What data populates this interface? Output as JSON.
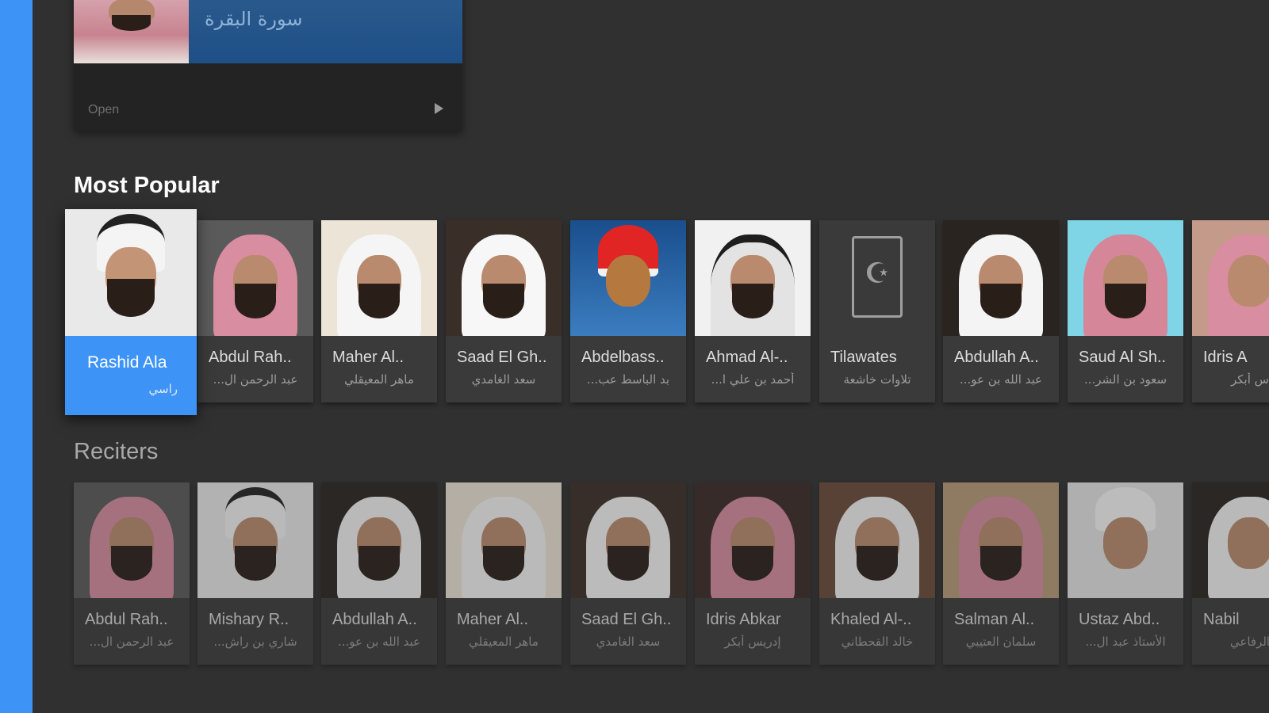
{
  "top_card": {
    "banner_text": "سورة البقرة",
    "open_label": "Open",
    "play_icon": "play-icon"
  },
  "sections": {
    "most_popular": "Most Popular",
    "reciters": "Reciters"
  },
  "most_popular": [
    {
      "name": "Rashid Ala",
      "subname": "راسي",
      "focused": true
    },
    {
      "name": "Abdul Rah..",
      "subname": "عبد الرحمن ال..."
    },
    {
      "name": "Maher Al..",
      "subname": "ماهر المعيقلي"
    },
    {
      "name": "Saad El Gh..",
      "subname": "سعد الغامدي"
    },
    {
      "name": "Abdelbass..",
      "subname": "بد الباسط عب..."
    },
    {
      "name": "Ahmad Al-..",
      "subname": "أحمد بن علي ا..."
    },
    {
      "name": "Tilawates",
      "subname": "تلاوات خاشعة",
      "icon": "book-icon"
    },
    {
      "name": "Abdullah A..",
      "subname": "عبد الله بن عو..."
    },
    {
      "name": "Saud Al Sh..",
      "subname": "سعود بن الشر..."
    },
    {
      "name": "Idris A",
      "subname": "س أبكر"
    }
  ],
  "reciters": [
    {
      "name": "Abdul Rah..",
      "subname": "عبد الرحمن ال..."
    },
    {
      "name": "Mishary R..",
      "subname": "شاري بن راش..."
    },
    {
      "name": "Abdullah A..",
      "subname": "عبد الله بن عو..."
    },
    {
      "name": "Maher Al..",
      "subname": "ماهر المعيقلي"
    },
    {
      "name": "Saad El Gh..",
      "subname": "سعد الغامدي"
    },
    {
      "name": "Idris Abkar",
      "subname": "إدريس أبكر"
    },
    {
      "name": "Khaled Al-..",
      "subname": "خالد القحطاني"
    },
    {
      "name": "Salman Al..",
      "subname": "سلمان العتيبي"
    },
    {
      "name": "Ustaz Abd..",
      "subname": "الأستاذ عبد ال..."
    },
    {
      "name": "Nabil",
      "subname": "الرفاعي"
    }
  ]
}
